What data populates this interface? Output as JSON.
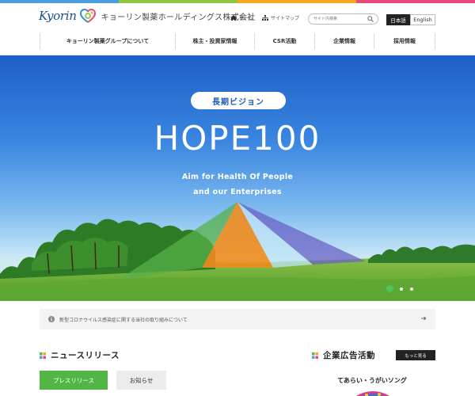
{
  "colors": {
    "accent_bar": [
      "#4a9ee0",
      "#8fc63f",
      "#f5a623",
      "#e64a7b"
    ],
    "press_tab": "#52b646",
    "hero_sky": "#2b72d6"
  },
  "brand": {
    "logo_word": "Kyorin",
    "company": "キョーリン製薬ホールディングス株式会社"
  },
  "header": {
    "home_label": "ホーム",
    "sitemap_label": "サイトマップ",
    "search_placeholder": "サイト内検索",
    "lang_ja": "日本語",
    "lang_en": "English"
  },
  "nav": {
    "items": [
      {
        "label": "キョーリン製薬グループについて"
      },
      {
        "label": "株主・投資家情報"
      },
      {
        "label": "CSR活動"
      },
      {
        "label": "企業情報"
      },
      {
        "label": "採用情報"
      }
    ]
  },
  "hero": {
    "pill": "長期ビジョン",
    "headline": "HOPE100",
    "tagline_1": "Aim for Health Of People",
    "tagline_2": "and our Enterprises",
    "slide_count": 3,
    "active_slide": 1
  },
  "notice": {
    "text": "新型コロナウイルス感染症に関する当社の取り組みについて"
  },
  "news": {
    "title": "ニュースリリース",
    "tabs": [
      "プレスリリース",
      "お知らせ"
    ],
    "active_tab": 0
  },
  "ads": {
    "title": "企業広告活動",
    "more_label": "もっと見る",
    "song_title": "てあらい・うがいソング"
  }
}
